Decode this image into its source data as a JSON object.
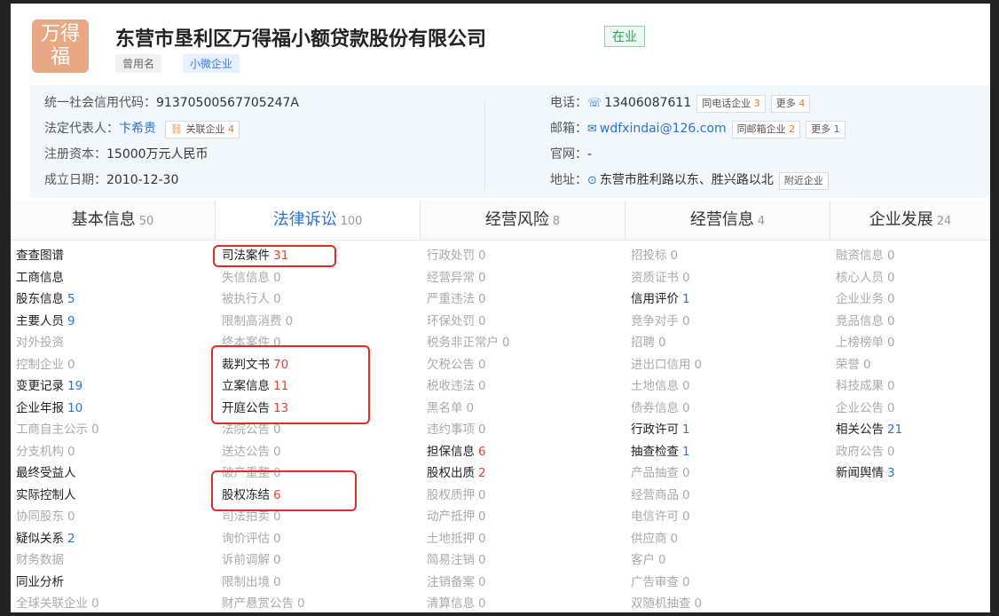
{
  "company": {
    "logo_line1": "万得",
    "logo_line2": "福",
    "name": "东营市垦利区万得福小额贷款股份有限公司",
    "status": "在业",
    "tags": [
      "曾用名",
      "小微企业"
    ]
  },
  "info": {
    "credit_code_label": "统一社会信用代码：",
    "credit_code": "91370500567705247A",
    "legal_rep_label": "法定代表人：",
    "legal_rep": "卞希贵",
    "related_label": "关联企业",
    "related_count": "4",
    "capital_label": "注册资本：",
    "capital": "15000万元人民币",
    "founded_label": "成立日期：",
    "founded": "2010-12-30",
    "phone_label": "电话：",
    "phone": "13406087611",
    "same_phone_label": "同电话企业",
    "same_phone_count": "3",
    "more_label": "更多",
    "more_phone_count": "4",
    "email_label": "邮箱：",
    "email": "wdfxindai@126.com",
    "same_email_label": "同邮箱企业",
    "same_email_count": "2",
    "more_email_count": "1",
    "website_label": "官网：",
    "website": "-",
    "address_label": "地址：",
    "address": "东营市胜利路以东、胜兴路以北",
    "nearby_label": "附近企业"
  },
  "tabs": [
    {
      "label": "基本信息",
      "count": "50"
    },
    {
      "label": "法律诉讼",
      "count": "100"
    },
    {
      "label": "经营风险",
      "count": "8"
    },
    {
      "label": "经营信息",
      "count": "4"
    },
    {
      "label": "企业发展",
      "count": "24"
    }
  ],
  "columns": [
    [
      {
        "label": "查查图谱",
        "count": "",
        "active": true
      },
      {
        "label": "工商信息",
        "count": "",
        "active": true
      },
      {
        "label": "股东信息",
        "count": "5",
        "active": true
      },
      {
        "label": "主要人员",
        "count": "9",
        "active": true
      },
      {
        "label": "对外投资",
        "count": "",
        "active": false
      },
      {
        "label": "控制企业",
        "count": "0",
        "active": false
      },
      {
        "label": "变更记录",
        "count": "19",
        "active": true
      },
      {
        "label": "企业年报",
        "count": "10",
        "active": true
      },
      {
        "label": "工商自主公示",
        "count": "0",
        "active": false
      },
      {
        "label": "分支机构",
        "count": "0",
        "active": false
      },
      {
        "label": "最终受益人",
        "count": "",
        "active": true
      },
      {
        "label": "实际控制人",
        "count": "",
        "active": true
      },
      {
        "label": "协同股东",
        "count": "0",
        "active": false
      },
      {
        "label": "疑似关系",
        "count": "2",
        "active": true
      },
      {
        "label": "财务数据",
        "count": "",
        "active": false
      },
      {
        "label": "同业分析",
        "count": "",
        "active": true
      },
      {
        "label": "全球关联企业",
        "count": "0",
        "active": false
      }
    ],
    [
      {
        "label": "司法案件",
        "count": "31",
        "active": true
      },
      {
        "label": "失信信息",
        "count": "0",
        "active": false
      },
      {
        "label": "被执行人",
        "count": "0",
        "active": false
      },
      {
        "label": "限制高消费",
        "count": "0",
        "active": false
      },
      {
        "label": "终本案件",
        "count": "0",
        "active": false
      },
      {
        "label": "裁判文书",
        "count": "70",
        "active": true
      },
      {
        "label": "立案信息",
        "count": "11",
        "active": true
      },
      {
        "label": "开庭公告",
        "count": "13",
        "active": true
      },
      {
        "label": "法院公告",
        "count": "0",
        "active": false
      },
      {
        "label": "送达公告",
        "count": "0",
        "active": false
      },
      {
        "label": "破产重整",
        "count": "0",
        "active": false
      },
      {
        "label": "股权冻结",
        "count": "6",
        "active": true
      },
      {
        "label": "司法拍卖",
        "count": "0",
        "active": false
      },
      {
        "label": "询价评估",
        "count": "0",
        "active": false
      },
      {
        "label": "诉前调解",
        "count": "0",
        "active": false
      },
      {
        "label": "限制出境",
        "count": "0",
        "active": false
      },
      {
        "label": "财产悬赏公告",
        "count": "0",
        "active": false
      }
    ],
    [
      {
        "label": "行政处罚",
        "count": "0",
        "active": false
      },
      {
        "label": "经营异常",
        "count": "0",
        "active": false
      },
      {
        "label": "严重违法",
        "count": "0",
        "active": false
      },
      {
        "label": "环保处罚",
        "count": "0",
        "active": false
      },
      {
        "label": "税务非正常户",
        "count": "0",
        "active": false
      },
      {
        "label": "欠税公告",
        "count": "0",
        "active": false
      },
      {
        "label": "税收违法",
        "count": "0",
        "active": false
      },
      {
        "label": "黑名单",
        "count": "0",
        "active": false
      },
      {
        "label": "违约事项",
        "count": "0",
        "active": false
      },
      {
        "label": "担保信息",
        "count": "6",
        "active": true
      },
      {
        "label": "股权出质",
        "count": "2",
        "active": true
      },
      {
        "label": "股权质押",
        "count": "0",
        "active": false
      },
      {
        "label": "动产抵押",
        "count": "0",
        "active": false
      },
      {
        "label": "土地抵押",
        "count": "0",
        "active": false
      },
      {
        "label": "简易注销",
        "count": "0",
        "active": false
      },
      {
        "label": "注销备案",
        "count": "0",
        "active": false
      },
      {
        "label": "清算信息",
        "count": "0",
        "active": false
      }
    ],
    [
      {
        "label": "招投标",
        "count": "0",
        "active": false
      },
      {
        "label": "资质证书",
        "count": "0",
        "active": false
      },
      {
        "label": "信用评价",
        "count": "1",
        "active": true
      },
      {
        "label": "竞争对手",
        "count": "0",
        "active": false
      },
      {
        "label": "招聘",
        "count": "0",
        "active": false
      },
      {
        "label": "进出口信用",
        "count": "0",
        "active": false
      },
      {
        "label": "土地信息",
        "count": "0",
        "active": false
      },
      {
        "label": "债券信息",
        "count": "0",
        "active": false
      },
      {
        "label": "行政许可",
        "count": "1",
        "active": true
      },
      {
        "label": "抽查检查",
        "count": "1",
        "active": true
      },
      {
        "label": "产品抽查",
        "count": "0",
        "active": false
      },
      {
        "label": "经营商品",
        "count": "0",
        "active": false
      },
      {
        "label": "电信许可",
        "count": "0",
        "active": false
      },
      {
        "label": "供应商",
        "count": "0",
        "active": false
      },
      {
        "label": "客户",
        "count": "0",
        "active": false
      },
      {
        "label": "广告审查",
        "count": "0",
        "active": false
      },
      {
        "label": "双随机抽查",
        "count": "0",
        "active": false
      }
    ],
    [
      {
        "label": "融资信息",
        "count": "0",
        "active": false
      },
      {
        "label": "核心人员",
        "count": "0",
        "active": false
      },
      {
        "label": "企业业务",
        "count": "0",
        "active": false
      },
      {
        "label": "竞品信息",
        "count": "0",
        "active": false
      },
      {
        "label": "上榜榜单",
        "count": "0",
        "active": false
      },
      {
        "label": "荣誉",
        "count": "0",
        "active": false
      },
      {
        "label": "科技成果",
        "count": "0",
        "active": false
      },
      {
        "label": "企业公告",
        "count": "0",
        "active": false
      },
      {
        "label": "相关公告",
        "count": "21",
        "active": true
      },
      {
        "label": "政府公告",
        "count": "0",
        "active": false
      },
      {
        "label": "新闻舆情",
        "count": "3",
        "active": true
      }
    ]
  ]
}
